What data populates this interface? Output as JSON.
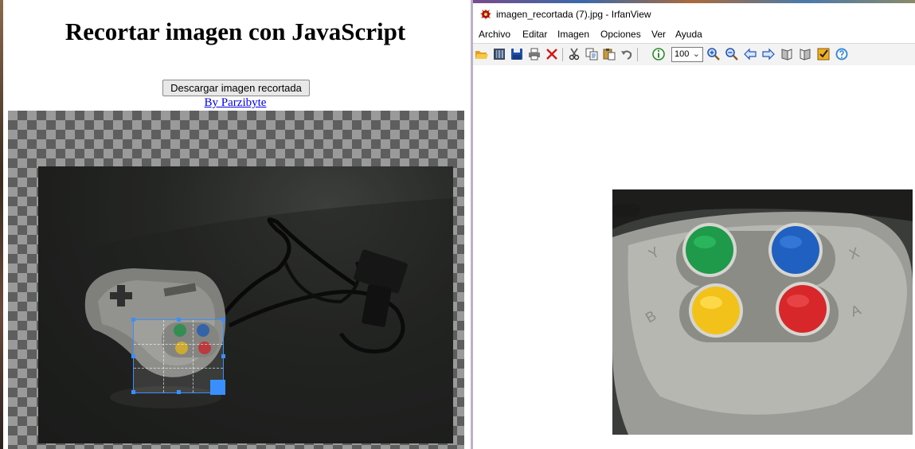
{
  "left_page": {
    "title": "Recortar imagen con JavaScript",
    "download_button": "Descargar imagen recortada",
    "author_link": "By Parzibyte"
  },
  "irfanview": {
    "window_title": "imagen_recortada (7).jpg - IrfanView",
    "menu": [
      "Archivo",
      "Editar",
      "Imagen",
      "Opciones",
      "Ver",
      "Ayuda"
    ],
    "zoom_value": "100",
    "toolbar_icons": [
      "open-folder-icon",
      "thumbnails-icon",
      "save-icon",
      "print-icon",
      "delete-icon",
      "cut-icon",
      "copy-icon",
      "paste-icon",
      "undo-icon",
      "info-icon",
      "zoom-in-icon",
      "zoom-out-icon",
      "previous-icon",
      "next-icon",
      "first-page-icon",
      "last-page-icon",
      "properties-icon",
      "help-icon"
    ]
  },
  "colors": {
    "link": "#0000ee",
    "crop_accent": "#3a8fff",
    "button_green": "#1e9a4a",
    "button_blue": "#2060c0",
    "button_yellow": "#f2c21a",
    "button_red": "#d8272b"
  }
}
